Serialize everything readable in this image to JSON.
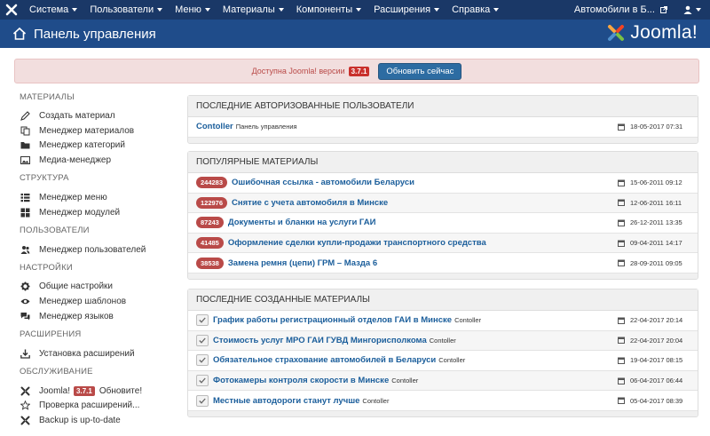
{
  "topnav": {
    "menu": [
      {
        "label": "Система"
      },
      {
        "label": "Пользователи"
      },
      {
        "label": "Меню"
      },
      {
        "label": "Материалы"
      },
      {
        "label": "Компоненты"
      },
      {
        "label": "Расширения"
      },
      {
        "label": "Справка"
      }
    ],
    "site_name": "Автомобили в Б..."
  },
  "header": {
    "title": "Панель управления",
    "brand": "Joomla!"
  },
  "alert": {
    "text": "Доступна Joomla! версии",
    "version": "3.7.1",
    "button_label": "Обновить сейчас"
  },
  "sidebar": {
    "sections": [
      {
        "title": "МАТЕРИАЛЫ",
        "items": [
          {
            "label": "Создать материал",
            "icon": "pencil-icon"
          },
          {
            "label": "Менеджер материалов",
            "icon": "copy-icon"
          },
          {
            "label": "Менеджер категорий",
            "icon": "folder-icon"
          },
          {
            "label": "Медиа-менеджер",
            "icon": "image-icon"
          }
        ]
      },
      {
        "title": "СТРУКТУРА",
        "items": [
          {
            "label": "Менеджер меню",
            "icon": "list-icon"
          },
          {
            "label": "Менеджер модулей",
            "icon": "cube-icon"
          }
        ]
      },
      {
        "title": "ПОЛЬЗОВАТЕЛИ",
        "items": [
          {
            "label": "Менеджер пользователей",
            "icon": "users-icon"
          }
        ]
      },
      {
        "title": "НАСТРОЙКИ",
        "items": [
          {
            "label": "Общие настройки",
            "icon": "cog-icon"
          },
          {
            "label": "Менеджер шаблонов",
            "icon": "eye-icon"
          },
          {
            "label": "Менеджер языков",
            "icon": "comments-icon"
          }
        ]
      },
      {
        "title": "РАСШИРЕНИЯ",
        "items": [
          {
            "label": "Установка расширений",
            "icon": "download-icon"
          }
        ]
      },
      {
        "title": "ОБСЛУЖИВАНИЕ",
        "items": [
          {
            "label": "Joomla!",
            "version": "3.7.1",
            "suffix": "Обновите!",
            "icon": "joomla-icon"
          },
          {
            "label": "Проверка расширений...",
            "icon": "star-icon"
          },
          {
            "label": "Backup is up-to-date",
            "icon": "joomla-icon"
          }
        ]
      }
    ]
  },
  "panels": {
    "users": {
      "title": "ПОСЛЕДНИЕ АВТОРИЗОВАННЫЕ ПОЛЬЗОВАТЕЛИ",
      "rows": [
        {
          "name": "Contoller",
          "location": "Панель управления",
          "date": "18-05-2017 07:31"
        }
      ]
    },
    "popular": {
      "title": "ПОПУЛЯРНЫЕ МАТЕРИАЛЫ",
      "rows": [
        {
          "hits": "244283",
          "title": "Ошибочная ссылка - автомобили Беларуси",
          "date": "15-06-2011 09:12"
        },
        {
          "hits": "122976",
          "title": "Снятие с учета автомобиля в Минске",
          "date": "12-06-2011 16:11"
        },
        {
          "hits": "87243",
          "title": "Документы и бланки на услуги ГАИ",
          "date": "26-12-2011 13:35"
        },
        {
          "hits": "41485",
          "title": "Оформление сделки купли-продажи транспортного средства",
          "date": "09-04-2011 14:17"
        },
        {
          "hits": "38538",
          "title": "Замена ремня (цепи) ГРМ – Мазда 6",
          "date": "28-09-2011 09:05"
        }
      ]
    },
    "recent": {
      "title": "ПОСЛЕДНИЕ СОЗДАННЫЕ МАТЕРИАЛЫ",
      "rows": [
        {
          "title": "График работы регистрационный отделов ГАИ в Минске",
          "author": "Contoller",
          "date": "22-04-2017 20:14"
        },
        {
          "title": "Стоимость услуг МРО ГАИ ГУВД Мингорисполкома",
          "author": "Contoller",
          "date": "22-04-2017 20:04"
        },
        {
          "title": "Обязательное страхование автомобилей в Беларуси",
          "author": "Contoller",
          "date": "19-04-2017 08:15"
        },
        {
          "title": "Фотокамеры контроля скорости в Минске",
          "author": "Contoller",
          "date": "06-04-2017 06:44"
        },
        {
          "title": "Местные автодороги станут лучше",
          "author": "Contoller",
          "date": "05-04-2017 08:39"
        }
      ]
    }
  },
  "colors": {
    "topnav_bg": "#1a3867",
    "header_bg": "#1f4c8a",
    "alert_bg": "#f2dede",
    "badge_red": "#b94a48",
    "link_blue": "#1b5e9b"
  }
}
